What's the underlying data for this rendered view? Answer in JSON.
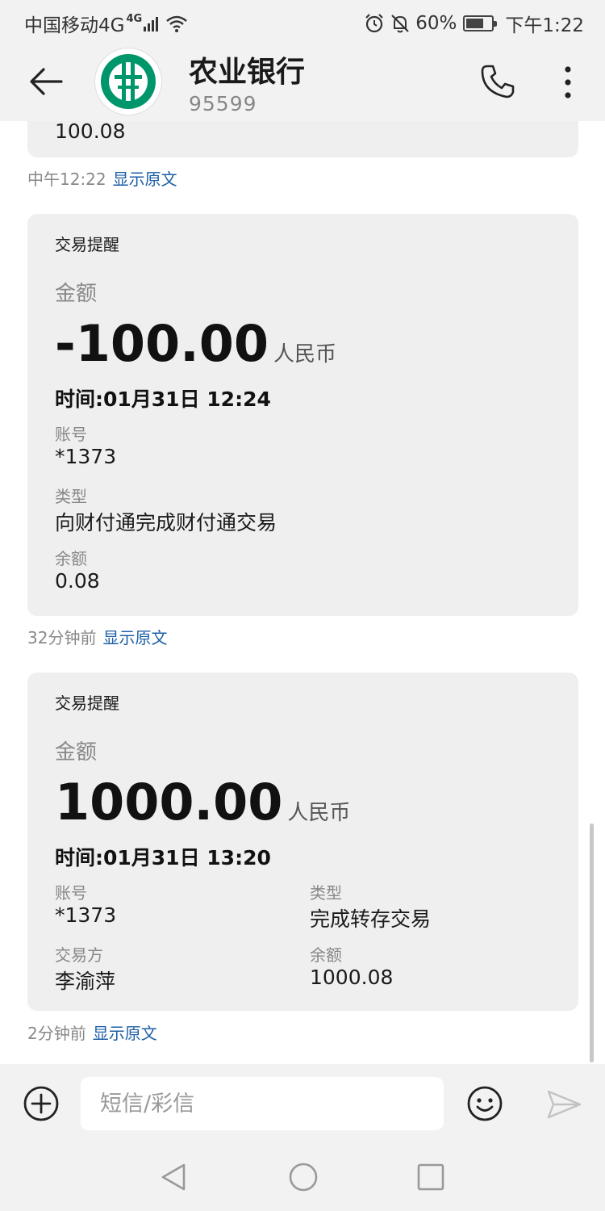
{
  "status_bar": {
    "carrier": "中国移动4G",
    "network_sup": "4G",
    "battery": "60%",
    "time": "下午1:22"
  },
  "header": {
    "title": "农业银行",
    "number": "95599"
  },
  "conversation": {
    "messages": [
      {
        "amount_partial": "100.08",
        "meta_time": "中午12:22",
        "show_original": "显示原文"
      },
      {
        "card_label": "交易提醒",
        "amount_label": "金额",
        "amount": "-100.00",
        "currency": "人民币",
        "time": "时间:01月31日 12:24",
        "account_label": "账号",
        "account": "*1373",
        "type_label": "类型",
        "type": "向财付通完成财付通交易",
        "balance_label": "余额",
        "balance": "0.08",
        "meta_time": "32分钟前",
        "show_original": "显示原文"
      },
      {
        "card_label": "交易提醒",
        "amount_label": "金额",
        "amount": "1000.00",
        "currency": "人民币",
        "time": "时间:01月31日 13:20",
        "account_label": "账号",
        "account": "*1373",
        "type_label": "类型",
        "type": "完成转存交易",
        "counterparty_label": "交易方",
        "counterparty": "李渝萍",
        "balance_label": "余额",
        "balance": "1000.08",
        "meta_time": "2分钟前",
        "show_original": "显示原文"
      }
    ]
  },
  "input_bar": {
    "placeholder": "短信/彩信"
  },
  "colors": {
    "link": "#1d5fa6",
    "bubble": "#efefef",
    "bar_bg": "#f2f2f2",
    "abc_green": "#00966b"
  }
}
